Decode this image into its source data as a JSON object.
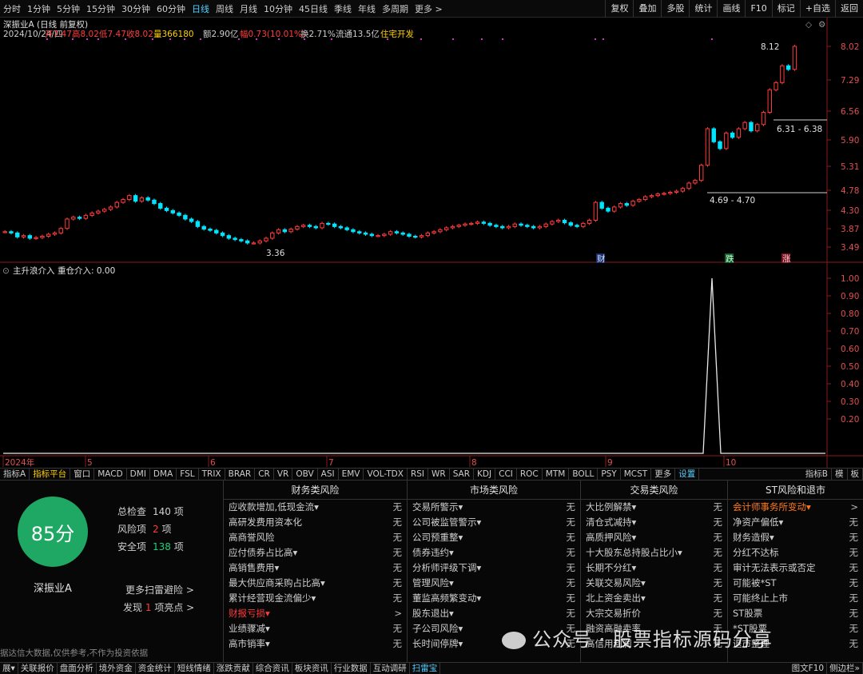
{
  "periods": [
    "分时",
    "1分钟",
    "5分钟",
    "15分钟",
    "30分钟",
    "60分钟",
    "日线",
    "周线",
    "月线",
    "10分钟",
    "45日线",
    "季线",
    "年线",
    "多周期",
    "更多 >"
  ],
  "active_period": "日线",
  "toolbar_right": [
    "复权",
    "叠加",
    "多股",
    "统计",
    "画线",
    "F10",
    "标记",
    "+自选",
    "返回"
  ],
  "stock": {
    "title": "深振业A (日线 前复权)",
    "info_date": "2024/10/24/四",
    "open_label": "开7.47",
    "high_label": "高8.02",
    "low_label": "低7.47",
    "close_label": "收8.02",
    "vol_label": "量366180",
    "amount_label": "额2.90亿",
    "change_label": "幅0.73(10.01%)",
    "turnover_label": "换2.71%",
    "float_label": "流通13.5亿",
    "sector_label": "住宅开发"
  },
  "price_axis": [
    "8.02",
    "7.29",
    "6.56",
    "5.90",
    "5.31",
    "4.78",
    "4.30",
    "3.87",
    "3.49"
  ],
  "annotations": {
    "high": "8.12",
    "low": "3.36",
    "range1": "6.31 - 6.38",
    "range2": "4.69 - 4.70"
  },
  "markers": {
    "cai": "财",
    "die": "跌",
    "zhang": "涨"
  },
  "indicator": {
    "name": "主升浪介入",
    "line_label": "重仓介入: 0.00",
    "axis": [
      "1.00",
      "0.90",
      "0.80",
      "0.70",
      "0.60",
      "0.50",
      "0.40",
      "0.30",
      "0.20"
    ]
  },
  "time_axis": [
    "2024年",
    "5",
    "6",
    "7",
    "8",
    "9",
    "10"
  ],
  "indicator_tabs": [
    "指标A",
    "指标平台",
    "窗口",
    "MACD",
    "DMI",
    "DMA",
    "FSL",
    "TRIX",
    "BRAR",
    "CR",
    "VR",
    "OBV",
    "ASI",
    "EMV",
    "VOL-TDX",
    "RSI",
    "WR",
    "SAR",
    "KDJ",
    "CCI",
    "ROC",
    "MTM",
    "BOLL",
    "PSY",
    "MCST",
    "更多",
    "设置"
  ],
  "indicator_tabs_right": [
    "指标B",
    "模",
    "板"
  ],
  "scan": {
    "score": "85分",
    "name": "深振业A",
    "total_label": "总检查",
    "total": "140",
    "unit": "项",
    "risk_label": "风险项",
    "risk": "2",
    "safe_label": "安全项",
    "safe": "138",
    "more": "更多扫雷避险 >",
    "found_a": "发现",
    "found_n": "1",
    "found_b": "项亮点 >",
    "disclaimer": "据达信大数据,仅供参考,不作为投资依据"
  },
  "columns": [
    {
      "title": "财务类风险",
      "rows": [
        {
          "k": "应收款增加,低现金流▾",
          "v": "无"
        },
        {
          "k": "高研发费用资本化",
          "v": "无"
        },
        {
          "k": "高商誉风险",
          "v": "无"
        },
        {
          "k": "应付债券占比高▾",
          "v": "无"
        },
        {
          "k": "高销售费用▾",
          "v": "无"
        },
        {
          "k": "最大供应商采购占比高▾",
          "v": "无"
        },
        {
          "k": "累计经营现金流偏少▾",
          "v": "无"
        },
        {
          "k": "财报亏损▾",
          "v": ">",
          "red": true
        },
        {
          "k": "业绩骤减▾",
          "v": "无"
        },
        {
          "k": "高市销率▾",
          "v": "无"
        }
      ]
    },
    {
      "title": "市场类风险",
      "rows": [
        {
          "k": "交易所警示▾",
          "v": "无"
        },
        {
          "k": "公司被监管警示▾",
          "v": "无"
        },
        {
          "k": "公司预重整▾",
          "v": "无"
        },
        {
          "k": "债券违约▾",
          "v": "无"
        },
        {
          "k": "分析师评级下调▾",
          "v": "无"
        },
        {
          "k": "管理风险▾",
          "v": "无"
        },
        {
          "k": "董监高频繁变动▾",
          "v": "无"
        },
        {
          "k": "股东退出▾",
          "v": "无"
        },
        {
          "k": "子公司风险▾",
          "v": "无"
        },
        {
          "k": "长时间停牌▾",
          "v": "无"
        }
      ]
    },
    {
      "title": "交易类风险",
      "rows": [
        {
          "k": "大比例解禁▾",
          "v": "无"
        },
        {
          "k": "清仓式减持▾",
          "v": "无"
        },
        {
          "k": "高质押风险▾",
          "v": "无"
        },
        {
          "k": "十大股东总持股占比小▾",
          "v": "无"
        },
        {
          "k": "长期不分红▾",
          "v": "无"
        },
        {
          "k": "关联交易风险▾",
          "v": "无"
        },
        {
          "k": "北上资金卖出▾",
          "v": "无"
        },
        {
          "k": "大宗交易折价",
          "v": "无"
        },
        {
          "k": "融资高融卖率",
          "v": "无"
        },
        {
          "k": "高信用利润",
          "v": "无"
        }
      ]
    },
    {
      "title": "ST风险和退市",
      "rows": [
        {
          "k": "会计师事务所变动▾",
          "v": ">",
          "org": true
        },
        {
          "k": "净资产偏低▾",
          "v": "无"
        },
        {
          "k": "财务造假▾",
          "v": "无"
        },
        {
          "k": "分红不达标",
          "v": "无"
        },
        {
          "k": "审计无法表示或否定",
          "v": "无"
        },
        {
          "k": "可能被*ST",
          "v": "无"
        },
        {
          "k": "可能终止上市",
          "v": "无"
        },
        {
          "k": "ST股票",
          "v": "无"
        },
        {
          "k": "*ST股票",
          "v": "无"
        },
        {
          "k": "退市整理",
          "v": "无"
        }
      ]
    }
  ],
  "bottom_tabs": [
    "展▾",
    "关联报价",
    "盘面分析",
    "境外资金",
    "资金统计",
    "短线情绪",
    "涨跌贡献",
    "综合资讯",
    "板块资讯",
    "行业数据",
    "互动调研",
    "扫雷宝"
  ],
  "bottom_right": [
    "图文F10",
    "侧边栏»"
  ],
  "watermark": "公众号 · 股票指标源码分享",
  "colors": {
    "up": "#ff3b3b",
    "down": "#00e5ff",
    "accent": "#56d0ff",
    "score": "#1fa863",
    "yellow": "#ffd000"
  }
}
